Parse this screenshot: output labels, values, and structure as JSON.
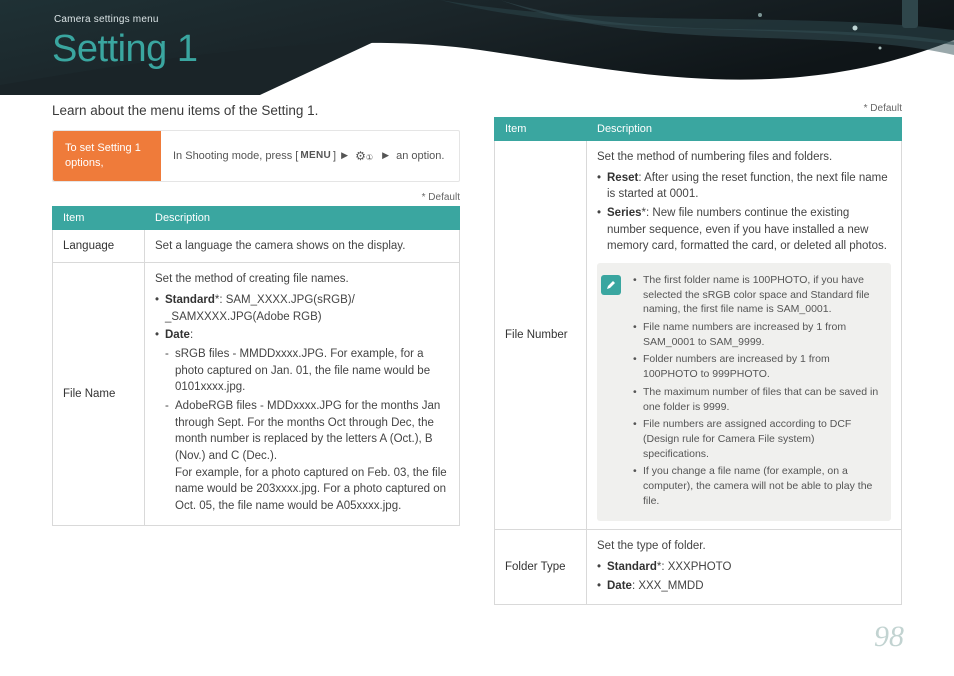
{
  "breadcrumb": "Camera settings menu",
  "title": "Setting 1",
  "intro": "Learn about the menu items of the Setting 1.",
  "instruction": {
    "left": "To set Setting 1 options,",
    "prefix": "In Shooting mode, press [",
    "menu": "MENU",
    "arrow": "▶",
    "gear": "⚙",
    "sub": "①",
    "suffix": "an option."
  },
  "default_note": "* Default",
  "headers": {
    "item": "Item",
    "desc": "Description"
  },
  "left_table": {
    "r1_item": "Language",
    "r1_desc": "Set a language the camera shows on the display.",
    "r2_item": "File Name",
    "r2_lead": "Set the method of creating file names.",
    "r2_b1_label": "Standard",
    "r2_b1_star": "*",
    "r2_b1_rest": ": SAM_XXXX.JPG(sRGB)/ _SAMXXXX.JPG(Adobe RGB)",
    "r2_b2_label": "Date",
    "r2_b2_colon": ":",
    "r2_d1": "sRGB files - MMDDxxxx.JPG. For example, for a photo captured on Jan. 01, the file name would be 0101xxxx.jpg.",
    "r2_d2": "AdobeRGB files - MDDxxxx.JPG for the months Jan through Sept. For the months Oct through Dec, the month number is replaced by the letters A (Oct.), B (Nov.) and C (Dec.).",
    "r2_d2b": "For example, for a photo captured on Feb. 03, the file name would be 203xxxx.jpg. For a photo captured on Oct. 05, the file name would be A05xxxx.jpg."
  },
  "right_table": {
    "r1_item": "File Number",
    "r1_lead": "Set the method of numbering files and folders.",
    "r1_b1_label": "Reset",
    "r1_b1_rest": ": After using the reset function, the next file name is started at 0001.",
    "r1_b2_label": "Series",
    "r1_b2_star": "*",
    "r1_b2_rest": ": New file numbers continue the existing number sequence, even if you have installed a new memory card, formatted the card, or deleted all photos.",
    "note1": "The first folder name is 100PHOTO, if you have selected the sRGB color space and Standard file naming, the first file name is SAM_0001.",
    "note2": "File name numbers are increased by 1 from SAM_0001 to SAM_9999.",
    "note3": "Folder numbers are increased by 1 from 100PHOTO to 999PHOTO.",
    "note4": "The maximum number of files that can be saved in one folder is 9999.",
    "note5": "File numbers are assigned according to DCF (Design rule for Camera File system) specifications.",
    "note6": "If you change a file name (for example, on a computer), the camera will not be able to play the file.",
    "r2_item": "Folder Type",
    "r2_lead": "Set the type of folder.",
    "r2_b1_label": "Standard",
    "r2_b1_star": "*",
    "r2_b1_rest": ": XXXPHOTO",
    "r2_b2_label": "Date",
    "r2_b2_rest": ": XXX_MMDD"
  },
  "page_number": "98"
}
